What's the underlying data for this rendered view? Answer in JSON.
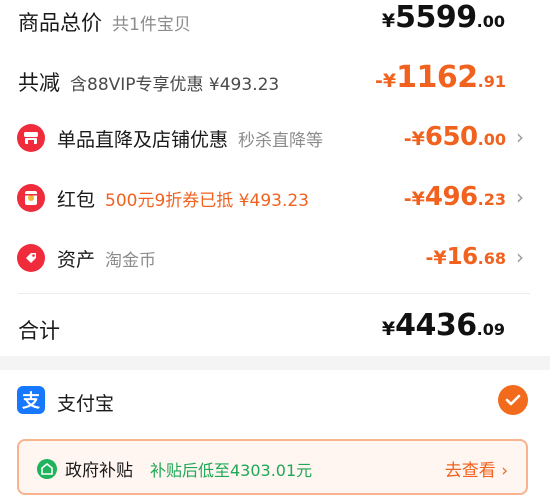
{
  "total_price": {
    "label": "商品总价",
    "count_text": "共1件宝贝",
    "yen": "¥",
    "int": "5599",
    "dec": ".00"
  },
  "discount": {
    "label": "共减",
    "note": "含88VIP专享优惠 ¥493.23",
    "yen": "-¥",
    "int": "1162",
    "dec": ".91"
  },
  "items": [
    {
      "label": "单品直降及店铺优惠",
      "note": "秒杀直降等",
      "yen": "-¥",
      "int": "650",
      "dec": ".00",
      "icon": "shop-icon"
    },
    {
      "label": "红包",
      "note": "500元9折券已抵 ¥493.23",
      "yen": "-¥",
      "int": "496",
      "dec": ".23",
      "icon": "red-packet-icon"
    },
    {
      "label": "资产",
      "note": "淘金币",
      "yen": "-¥",
      "int": "16",
      "dec": ".68",
      "icon": "coin-tag-icon"
    }
  ],
  "sum": {
    "label": "合计",
    "yen": "¥",
    "int": "4436",
    "dec": ".09"
  },
  "payment": {
    "label": "支付宝",
    "icon_glyph": "支",
    "selected": true
  },
  "subsidy": {
    "label": "政府补贴",
    "note": "补贴后低至4303.01元",
    "link": "去查看",
    "link_chev": "›"
  },
  "chev": "›",
  "colors": {
    "accent": "#f1621f",
    "alipay": "#1677ff",
    "check": "#f26b1d",
    "gov_green": "#1fb35c",
    "icon_red": "#f02b3c"
  }
}
